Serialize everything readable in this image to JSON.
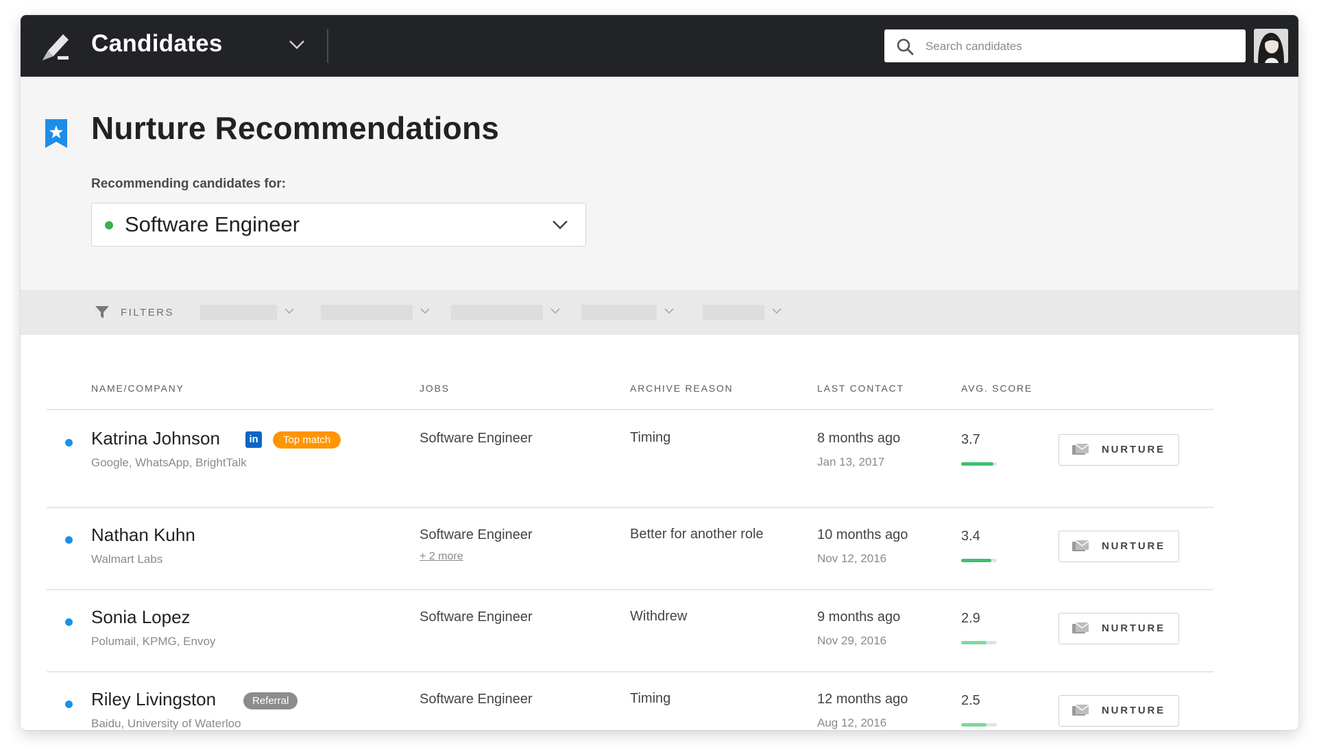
{
  "app": {
    "title": "Candidates",
    "search_placeholder": "Search candidates"
  },
  "page": {
    "title": "Nurture Recommendations",
    "recommending_label": "Recommending candidates for:",
    "selected_job": "Software Engineer",
    "job_status_color": "#37b24d"
  },
  "filters": {
    "label": "FILTERS"
  },
  "table": {
    "headers": {
      "name_company": "NAME/COMPANY",
      "jobs": "JOBS",
      "archive_reason": "ARCHIVE REASON",
      "last_contact": "LAST CONTACT",
      "avg_score": "AVG. SCORE"
    },
    "action_label": "NURTURE",
    "rows": [
      {
        "name": "Katrina Johnson",
        "company": "Google, WhatsApp, BrightTalk",
        "linkedin": "in",
        "badge": "Top match",
        "job": "Software Engineer",
        "more": "",
        "reason": "Timing",
        "contact": "8 months ago",
        "date": "Jan 13, 2017",
        "score": "3.7",
        "score_fraction": 0.9,
        "score_color": "#3fbf6a"
      },
      {
        "name": "Nathan Kuhn",
        "company": "Walmart Labs",
        "job": "Software Engineer",
        "more": "+ 2 more",
        "reason": "Better for another role",
        "contact": "10 months ago",
        "date": "Nov 12, 2016",
        "score": "3.4",
        "score_fraction": 0.85,
        "score_color": "#3fbf6a"
      },
      {
        "name": "Sonia Lopez",
        "company": "Polumail, KPMG, Envoy",
        "job": "Software Engineer",
        "more": "",
        "reason": "Withdrew",
        "contact": "9 months ago",
        "date": "Nov 29, 2016",
        "score": "2.9",
        "score_fraction": 0.72,
        "score_color": "#7dd99a"
      },
      {
        "name": "Riley Livingston",
        "company": "Baidu, University of Waterloo",
        "badge_ref": "Referral",
        "job": "Software Engineer",
        "more": "",
        "reason": "Timing",
        "contact": "12 months ago",
        "date": "Aug 12, 2016",
        "score": "2.5",
        "score_fraction": 0.72,
        "score_color": "#7dd99a"
      }
    ]
  },
  "colors": {
    "topbar": "#222326",
    "accent_blue": "#1991eb",
    "top_match": "#ff9500",
    "referral": "#8c8c8c",
    "linkedin": "#0a66c2"
  }
}
